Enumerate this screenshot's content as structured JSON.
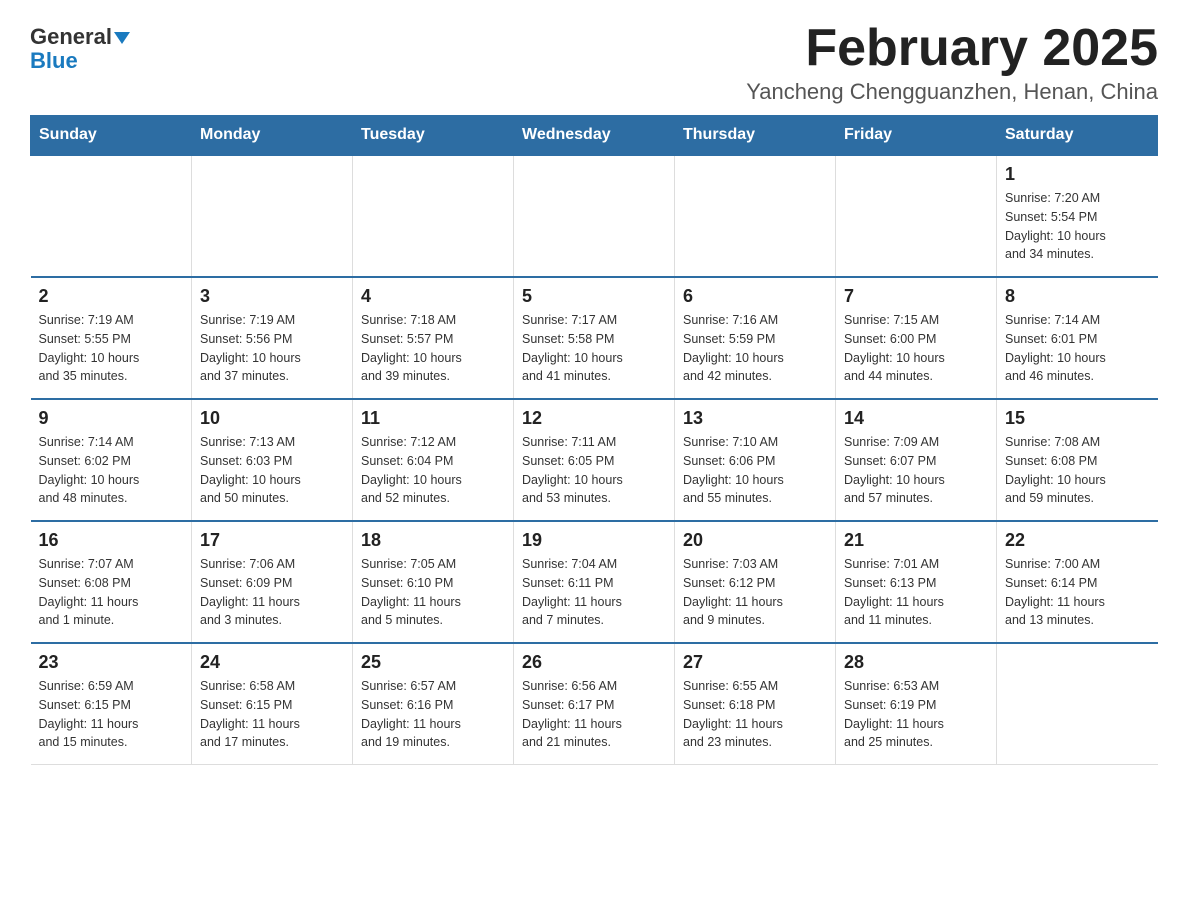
{
  "header": {
    "logo_general": "General",
    "logo_blue": "Blue",
    "title": "February 2025",
    "subtitle": "Yancheng Chengguanzhen, Henan, China"
  },
  "calendar": {
    "days_of_week": [
      "Sunday",
      "Monday",
      "Tuesday",
      "Wednesday",
      "Thursday",
      "Friday",
      "Saturday"
    ],
    "weeks": [
      [
        {
          "day": "",
          "info": ""
        },
        {
          "day": "",
          "info": ""
        },
        {
          "day": "",
          "info": ""
        },
        {
          "day": "",
          "info": ""
        },
        {
          "day": "",
          "info": ""
        },
        {
          "day": "",
          "info": ""
        },
        {
          "day": "1",
          "info": "Sunrise: 7:20 AM\nSunset: 5:54 PM\nDaylight: 10 hours\nand 34 minutes."
        }
      ],
      [
        {
          "day": "2",
          "info": "Sunrise: 7:19 AM\nSunset: 5:55 PM\nDaylight: 10 hours\nand 35 minutes."
        },
        {
          "day": "3",
          "info": "Sunrise: 7:19 AM\nSunset: 5:56 PM\nDaylight: 10 hours\nand 37 minutes."
        },
        {
          "day": "4",
          "info": "Sunrise: 7:18 AM\nSunset: 5:57 PM\nDaylight: 10 hours\nand 39 minutes."
        },
        {
          "day": "5",
          "info": "Sunrise: 7:17 AM\nSunset: 5:58 PM\nDaylight: 10 hours\nand 41 minutes."
        },
        {
          "day": "6",
          "info": "Sunrise: 7:16 AM\nSunset: 5:59 PM\nDaylight: 10 hours\nand 42 minutes."
        },
        {
          "day": "7",
          "info": "Sunrise: 7:15 AM\nSunset: 6:00 PM\nDaylight: 10 hours\nand 44 minutes."
        },
        {
          "day": "8",
          "info": "Sunrise: 7:14 AM\nSunset: 6:01 PM\nDaylight: 10 hours\nand 46 minutes."
        }
      ],
      [
        {
          "day": "9",
          "info": "Sunrise: 7:14 AM\nSunset: 6:02 PM\nDaylight: 10 hours\nand 48 minutes."
        },
        {
          "day": "10",
          "info": "Sunrise: 7:13 AM\nSunset: 6:03 PM\nDaylight: 10 hours\nand 50 minutes."
        },
        {
          "day": "11",
          "info": "Sunrise: 7:12 AM\nSunset: 6:04 PM\nDaylight: 10 hours\nand 52 minutes."
        },
        {
          "day": "12",
          "info": "Sunrise: 7:11 AM\nSunset: 6:05 PM\nDaylight: 10 hours\nand 53 minutes."
        },
        {
          "day": "13",
          "info": "Sunrise: 7:10 AM\nSunset: 6:06 PM\nDaylight: 10 hours\nand 55 minutes."
        },
        {
          "day": "14",
          "info": "Sunrise: 7:09 AM\nSunset: 6:07 PM\nDaylight: 10 hours\nand 57 minutes."
        },
        {
          "day": "15",
          "info": "Sunrise: 7:08 AM\nSunset: 6:08 PM\nDaylight: 10 hours\nand 59 minutes."
        }
      ],
      [
        {
          "day": "16",
          "info": "Sunrise: 7:07 AM\nSunset: 6:08 PM\nDaylight: 11 hours\nand 1 minute."
        },
        {
          "day": "17",
          "info": "Sunrise: 7:06 AM\nSunset: 6:09 PM\nDaylight: 11 hours\nand 3 minutes."
        },
        {
          "day": "18",
          "info": "Sunrise: 7:05 AM\nSunset: 6:10 PM\nDaylight: 11 hours\nand 5 minutes."
        },
        {
          "day": "19",
          "info": "Sunrise: 7:04 AM\nSunset: 6:11 PM\nDaylight: 11 hours\nand 7 minutes."
        },
        {
          "day": "20",
          "info": "Sunrise: 7:03 AM\nSunset: 6:12 PM\nDaylight: 11 hours\nand 9 minutes."
        },
        {
          "day": "21",
          "info": "Sunrise: 7:01 AM\nSunset: 6:13 PM\nDaylight: 11 hours\nand 11 minutes."
        },
        {
          "day": "22",
          "info": "Sunrise: 7:00 AM\nSunset: 6:14 PM\nDaylight: 11 hours\nand 13 minutes."
        }
      ],
      [
        {
          "day": "23",
          "info": "Sunrise: 6:59 AM\nSunset: 6:15 PM\nDaylight: 11 hours\nand 15 minutes."
        },
        {
          "day": "24",
          "info": "Sunrise: 6:58 AM\nSunset: 6:15 PM\nDaylight: 11 hours\nand 17 minutes."
        },
        {
          "day": "25",
          "info": "Sunrise: 6:57 AM\nSunset: 6:16 PM\nDaylight: 11 hours\nand 19 minutes."
        },
        {
          "day": "26",
          "info": "Sunrise: 6:56 AM\nSunset: 6:17 PM\nDaylight: 11 hours\nand 21 minutes."
        },
        {
          "day": "27",
          "info": "Sunrise: 6:55 AM\nSunset: 6:18 PM\nDaylight: 11 hours\nand 23 minutes."
        },
        {
          "day": "28",
          "info": "Sunrise: 6:53 AM\nSunset: 6:19 PM\nDaylight: 11 hours\nand 25 minutes."
        },
        {
          "day": "",
          "info": ""
        }
      ]
    ]
  }
}
